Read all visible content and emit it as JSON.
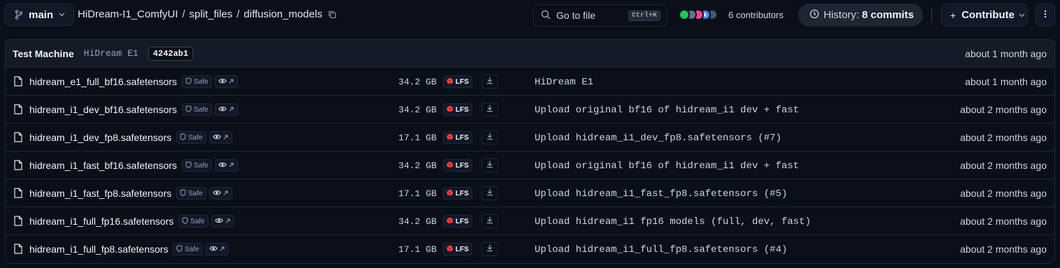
{
  "branch": {
    "label": "main"
  },
  "breadcrumb": {
    "repo": "HiDream-I1_ComfyUI",
    "folder": "split_files",
    "current": "diffusion_models",
    "separator": "/"
  },
  "search": {
    "label": "Go to file",
    "shortcut": "Ctrl+K"
  },
  "contributors": {
    "label": "6 contributors",
    "avatars": [
      {
        "color": "#22c55e",
        "letter": ""
      },
      {
        "color": "#64748b",
        "letter": ""
      },
      {
        "color": "#ec4899",
        "letter": ""
      },
      {
        "color": "#3b82f6",
        "letter": "k"
      },
      {
        "color": "#475569",
        "letter": ""
      }
    ]
  },
  "history": {
    "label": "History:",
    "count": "8 commits"
  },
  "contribute": {
    "label": "Contribute"
  },
  "last_commit": {
    "author": "Test Machine",
    "message": "HiDream E1",
    "sha": "4242ab1",
    "date": "about 1 month ago"
  },
  "files": [
    {
      "name": "hidream_e1_full_bf16.safetensors",
      "safe": "Safe",
      "size": "34.2 GB",
      "lfs": "LFS",
      "commit": "HiDream E1",
      "date": "about 1 month ago"
    },
    {
      "name": "hidream_i1_dev_bf16.safetensors",
      "safe": "Safe",
      "size": "34.2 GB",
      "lfs": "LFS",
      "commit": "Upload original bf16 of hidream_i1 dev + fast",
      "date": "about 2 months ago"
    },
    {
      "name": "hidream_i1_dev_fp8.safetensors",
      "safe": "Safe",
      "size": "17.1 GB",
      "lfs": "LFS",
      "commit": "Upload hidream_i1_dev_fp8.safetensors (#7)",
      "date": "about 2 months ago"
    },
    {
      "name": "hidream_i1_fast_bf16.safetensors",
      "safe": "Safe",
      "size": "34.2 GB",
      "lfs": "LFS",
      "commit": "Upload original bf16 of hidream_i1 dev + fast",
      "date": "about 2 months ago"
    },
    {
      "name": "hidream_i1_fast_fp8.safetensors",
      "safe": "Safe",
      "size": "17.1 GB",
      "lfs": "LFS",
      "commit": "Upload hidream_i1_fast_fp8.safetensors (#5)",
      "date": "about 2 months ago"
    },
    {
      "name": "hidream_i1_full_fp16.safetensors",
      "safe": "Safe",
      "size": "34.2 GB",
      "lfs": "LFS",
      "commit": "Upload hidream_i1 fp16 models (full, dev, fast)",
      "date": "about 2 months ago"
    },
    {
      "name": "hidream_i1_full_fp8.safetensors",
      "safe": "Safe",
      "size": "17.1 GB",
      "lfs": "LFS",
      "commit": "Upload hidream_i1_full_fp8.safetensors (#4)",
      "date": "about 2 months ago"
    }
  ],
  "icons": {
    "branch": "git-branch-icon",
    "copy": "copy-icon",
    "search": "search-icon",
    "history": "clock-icon",
    "file": "file-icon",
    "safe": "shield-icon",
    "viewer": "eye-arrow-icon",
    "lfs": "lfs-cube-icon",
    "download": "download-icon"
  },
  "colors": {
    "background": "#0b0f19",
    "lfs_red": "#ef4444"
  }
}
